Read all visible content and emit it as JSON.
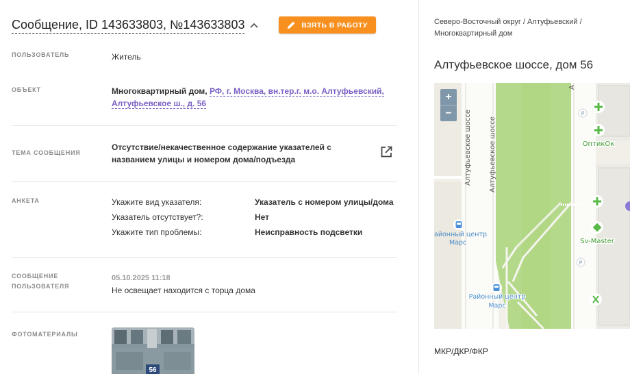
{
  "message": {
    "title": "Сообщение, ID 143633803, №143633803",
    "take_button": "ВЗЯТЬ В РАБОТУ"
  },
  "fields": {
    "user_label": "ПОЛЬЗОВАТЕЛЬ",
    "user_value": "Житель",
    "object_label": "ОБЪЕКТ",
    "object_type": "Многоквартирный дом,",
    "object_address_line1": "РФ, г. Москва, вн.тер.г. м.о. Алтуфьевский,",
    "object_address_line2": "Алтуфьевское ш., д. 56",
    "topic_label": "ТЕМА СООБЩЕНИЯ",
    "topic_line1": "Отсутствие/некачественное содержание указателей с",
    "topic_line2": "названием улицы и номером дома/подъезда",
    "survey_label": "АНКЕТА",
    "survey": [
      {
        "q": "Укажите вид указателя:",
        "a": "Указатель с номером улицы/дома"
      },
      {
        "q": "Указатель отсутствует?:",
        "a": "Нет"
      },
      {
        "q": "Укажите тип проблемы:",
        "a": "Неисправность подсветки"
      }
    ],
    "user_msg_label_1": "СООБЩЕНИЕ",
    "user_msg_label_2": "ПОЛЬЗОВАТЕЛЯ",
    "user_msg_date": "05.10.2025 11:18",
    "user_msg_text": "Не освещает находится с торца дома",
    "photos_label": "ФОТОМАТЕРИАЛЫ",
    "photo_house_number": "56"
  },
  "sidebar": {
    "breadcrumb_line1": "Северо-Восточный округ / Алтуфьевский /",
    "breadcrumb_line2": "Многоквартирный дом",
    "address_title": "Алтуфьевское шоссе, дом 56",
    "map": {
      "zoom_in": "+",
      "zoom_out": "−",
      "street_label_1": "Алтуфьевское шоссе",
      "street_label_2": "Алтуфьевское шоссе",
      "street_label_3": "А",
      "poi_optikok": "ОптикОк",
      "poi_svmaster": "Sv-Master",
      "poi_center_1a": "айонный центр",
      "poi_center_1b": "Марс",
      "poi_center_2a": "Районный центр",
      "poi_center_2b": "Марс",
      "parking_1": "P",
      "parking_2": "P"
    },
    "category": "МКР/ДКР/ФКР"
  },
  "colors": {
    "accent_orange": "#f7901e",
    "link_purple": "#7a5fc4",
    "map_green": "#b5d98a",
    "poi_green": "#58b946"
  }
}
